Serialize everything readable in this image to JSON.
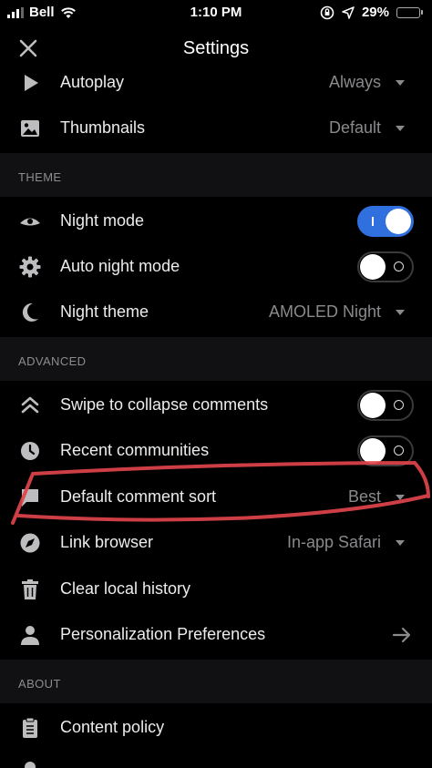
{
  "status": {
    "carrier": "Bell",
    "time": "1:10 PM",
    "battery": "29%",
    "battery_level": 0.29
  },
  "header": {
    "title": "Settings",
    "close_icon": "close-icon"
  },
  "rows_top": [
    {
      "label": "Autoplay",
      "value": "Always",
      "icon": "play-icon"
    },
    {
      "label": "Thumbnails",
      "value": "Default",
      "icon": "image-icon"
    }
  ],
  "sections": {
    "theme": "THEME",
    "advanced": "ADVANCED",
    "about": "ABOUT"
  },
  "theme": {
    "night_mode": {
      "label": "Night mode",
      "on": true,
      "icon": "eye-icon"
    },
    "auto_night_mode": {
      "label": "Auto night mode",
      "on": false,
      "icon": "gear-icon"
    },
    "night_theme": {
      "label": "Night theme",
      "value": "AMOLED Night",
      "icon": "moon-icon"
    }
  },
  "advanced": {
    "swipe_collapse": {
      "label": "Swipe to collapse comments",
      "on": false,
      "icon": "collapse-icon"
    },
    "recent_communities": {
      "label": "Recent communities",
      "on": false,
      "icon": "clock-icon"
    },
    "default_comment_sort": {
      "label": "Default comment sort",
      "value": "Best",
      "icon": "comment-icon"
    },
    "link_browser": {
      "label": "Link browser",
      "value": "In-app Safari",
      "icon": "compass-icon"
    },
    "clear_history": {
      "label": "Clear local history",
      "icon": "trash-icon"
    },
    "personalization": {
      "label": "Personalization Preferences",
      "icon": "person-icon"
    }
  },
  "about": {
    "content_policy": {
      "label": "Content policy",
      "icon": "clipboard-icon"
    }
  },
  "colors": {
    "accent": "#2f6fde",
    "annotation": "#e0434b",
    "value_text": "#8a8a8d"
  }
}
